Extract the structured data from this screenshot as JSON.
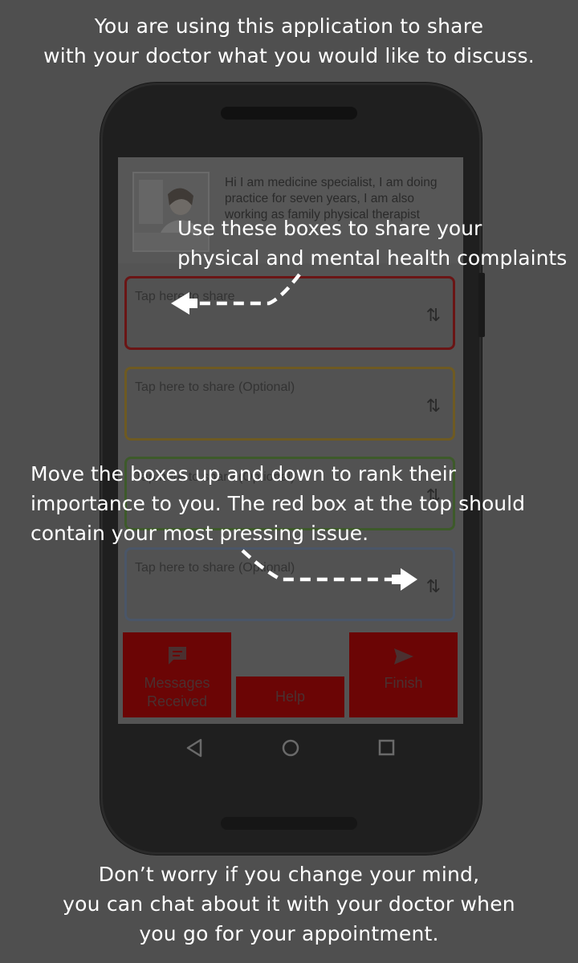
{
  "captions": {
    "top_line1": "You are using this application to share",
    "top_line2": "with your doctor what you would like to discuss.",
    "boxes_line1": "Use these boxes to share your",
    "boxes_line2": "physical and mental health complaints",
    "move_line1": "Move the boxes up and down to rank their",
    "move_line2": "importance to you. The red box at the top should",
    "move_line3": "contain your most pressing issue.",
    "bottom_line1": "Don’t worry if you change your mind,",
    "bottom_line2": "you can chat about it with your doctor when",
    "bottom_line3": "you go for your appointment."
  },
  "doctor": {
    "bio": "Hi I am medicine specialist, I am doing practice for seven years,  I am also working as family physical therapist"
  },
  "share_boxes": [
    {
      "placeholder": "Tap here to share",
      "color": "#d32f2f"
    },
    {
      "placeholder": "Tap here to share (Optional)",
      "color": "#f5a623"
    },
    {
      "placeholder": "Tap here to share (Optional)",
      "color": "#6aa84f"
    },
    {
      "placeholder": "Tap here to share (Optional)",
      "color": "#9fb3cc"
    }
  ],
  "buttons": {
    "messages": "Messages Received",
    "help": "Help",
    "finish": "Finish"
  },
  "colors": {
    "accent_red": "#e00000",
    "overlay": "#4f4f4f"
  }
}
